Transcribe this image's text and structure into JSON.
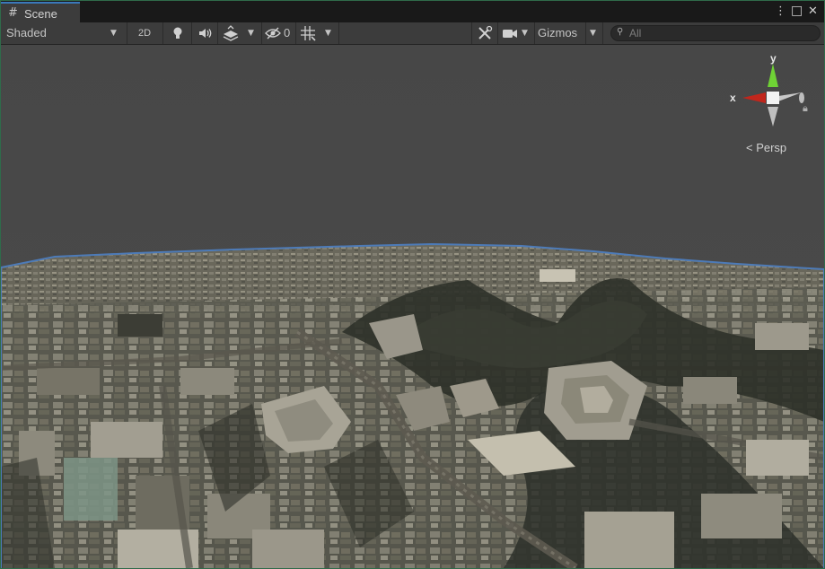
{
  "window": {
    "tab_label": "Scene",
    "tab_icon": "hash-grid-icon",
    "more_icon": "⋮",
    "maximize_icon": "□",
    "close_icon": "✕"
  },
  "toolbar": {
    "draw_mode": "Shaded",
    "mode_2d": "2D",
    "hidden_count": "0",
    "gizmos_label": "Gizmos",
    "search_placeholder": "All",
    "search_value": ""
  },
  "scene_gizmo": {
    "x_label": "x",
    "y_label": "y",
    "projection_label": "< Persp",
    "x_color": "#c1261c",
    "y_color": "#6fd135",
    "z_color": "#c8c8c8"
  },
  "colors": {
    "accent": "#3a79bb",
    "panel": "#3c3c3c",
    "sky": "#474747",
    "terrain_edge": "#4d7bb8"
  }
}
